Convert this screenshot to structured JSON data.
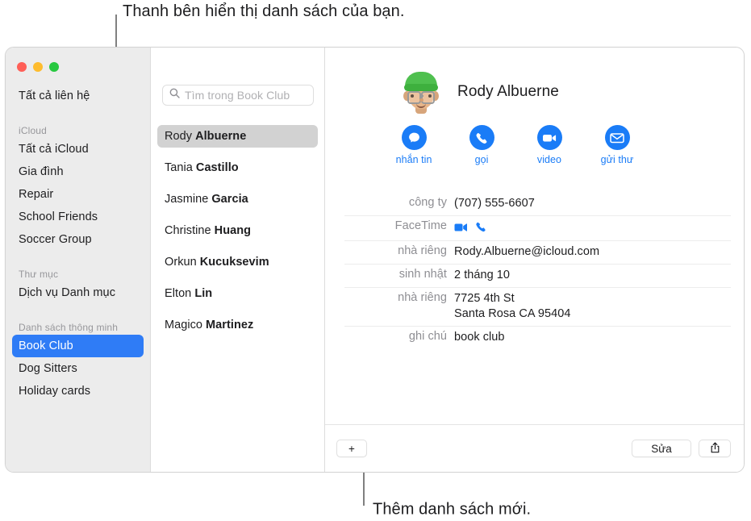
{
  "callouts": {
    "top": "Thanh bên hiển thị danh sách của bạn.",
    "bottom": "Thêm danh sách mới."
  },
  "window": {
    "traffic_lights": {
      "close": "close-button",
      "minimize": "minimize-button",
      "maximize": "maximize-button"
    }
  },
  "sidebar": {
    "top_item": "Tất cả liên hệ",
    "sections": [
      {
        "header": "iCloud",
        "items": [
          "Tất cả iCloud",
          "Gia đình",
          "Repair",
          "School Friends",
          "Soccer Group"
        ]
      },
      {
        "header": "Thư mục",
        "items": [
          "Dịch vụ Danh mục"
        ]
      },
      {
        "header": "Danh sách thông minh",
        "items": [
          "Book Club",
          "Dog Sitters",
          "Holiday cards"
        ]
      }
    ],
    "selected": "Book Club",
    "selected_color": "#2f7cf6"
  },
  "list_column": {
    "search": {
      "placeholder": "Tìm trong Book Club",
      "value": "",
      "icon": "search-icon"
    },
    "contacts": [
      {
        "first": "Rody",
        "last": "Albuerne"
      },
      {
        "first": "Tania",
        "last": "Castillo"
      },
      {
        "first": "Jasmine",
        "last": "Garcia"
      },
      {
        "first": "Christine",
        "last": "Huang"
      },
      {
        "first": "Orkun",
        "last": "Kucuksevim"
      },
      {
        "first": "Elton",
        "last": "Lin"
      },
      {
        "first": "Magico",
        "last": "Martinez"
      }
    ],
    "selected_index": 0
  },
  "detail": {
    "name": "Rody Albuerne",
    "avatar": "memoji-avatar",
    "accent_color": "#1a7cf7",
    "actions": [
      {
        "label": "nhắn tin",
        "icon": "message-bubble-icon"
      },
      {
        "label": "gọi",
        "icon": "phone-icon"
      },
      {
        "label": "video",
        "icon": "video-camera-icon"
      },
      {
        "label": "gửi thư",
        "icon": "envelope-icon"
      }
    ],
    "fields": [
      {
        "label": "công ty",
        "value": "(707) 555-6607",
        "type": "text"
      },
      {
        "label": "FaceTime",
        "value": "",
        "type": "icons",
        "icons": [
          "video-camera-icon",
          "phone-icon"
        ]
      },
      {
        "label": "nhà riêng",
        "value": "Rody.Albuerne@icloud.com",
        "type": "text"
      },
      {
        "label": "sinh nhật",
        "value": "2 tháng 10",
        "type": "text"
      },
      {
        "label": "nhà riêng",
        "value": "7725 4th St\nSanta Rosa CA 95404",
        "type": "text"
      },
      {
        "label": "ghi chú",
        "value": "book club",
        "type": "text"
      }
    ]
  },
  "bottom_bar": {
    "add_label": "+",
    "edit_label": "Sửa",
    "share_icon": "share-icon"
  }
}
